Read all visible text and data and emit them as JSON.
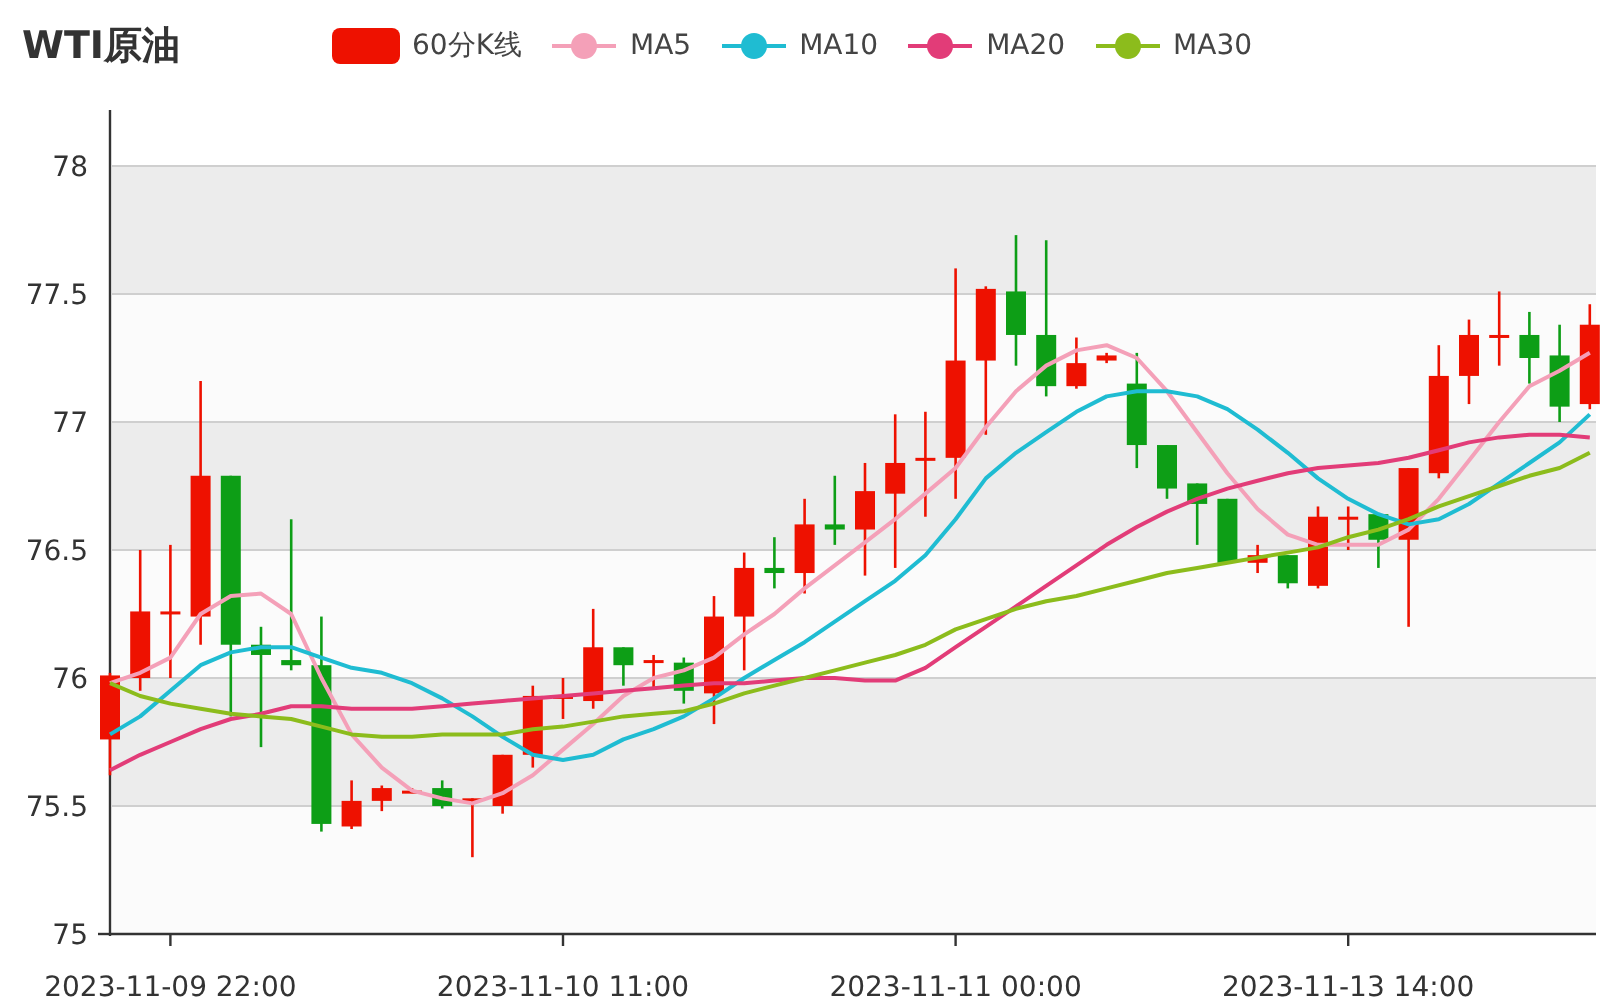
{
  "title": "WTI原油",
  "candle_legend": {
    "label": "60分K线",
    "color": "#ee1100"
  },
  "chart": {
    "chart_data": {
      "type": "candlestick",
      "grid": true,
      "ylim": [
        75,
        78
      ],
      "yticks": [
        75,
        75.5,
        76,
        76.5,
        77,
        77.5,
        78
      ],
      "categories": [
        null,
        null,
        "2023-11-09 22:00",
        null,
        null,
        null,
        null,
        null,
        null,
        null,
        null,
        null,
        null,
        null,
        null,
        "2023-11-10 11:00",
        null,
        null,
        null,
        null,
        null,
        null,
        null,
        null,
        null,
        null,
        null,
        null,
        "2023-11-11 00:00",
        null,
        null,
        null,
        null,
        null,
        null,
        null,
        null,
        null,
        null,
        null,
        null,
        "2023-11-13 14:00",
        null,
        null,
        null,
        null,
        null,
        null,
        null,
        null
      ],
      "ohlc": [
        [
          75.76,
          76.02,
          75.62,
          76.01
        ],
        [
          76.0,
          76.5,
          75.95,
          76.26
        ],
        [
          76.25,
          76.52,
          76.0,
          76.26
        ],
        [
          76.24,
          77.16,
          76.13,
          76.79
        ],
        [
          76.79,
          76.79,
          75.85,
          76.13
        ],
        [
          76.13,
          76.2,
          75.73,
          76.09
        ],
        [
          76.07,
          76.62,
          76.03,
          76.05
        ],
        [
          76.05,
          76.24,
          75.4,
          75.43
        ],
        [
          75.42,
          75.6,
          75.41,
          75.52
        ],
        [
          75.52,
          75.58,
          75.48,
          75.57
        ],
        [
          75.56,
          75.57,
          75.55,
          75.56
        ],
        [
          75.57,
          75.6,
          75.49,
          75.5
        ],
        [
          75.52,
          75.53,
          75.3,
          75.53
        ],
        [
          75.5,
          75.7,
          75.47,
          75.7
        ],
        [
          75.7,
          75.97,
          75.65,
          75.93
        ],
        [
          75.92,
          76.0,
          75.84,
          75.93
        ],
        [
          75.91,
          76.27,
          75.88,
          76.12
        ],
        [
          76.12,
          76.12,
          75.97,
          76.05
        ],
        [
          76.06,
          76.09,
          75.96,
          76.07
        ],
        [
          76.06,
          76.08,
          75.9,
          75.95
        ],
        [
          75.94,
          76.32,
          75.82,
          76.24
        ],
        [
          76.24,
          76.49,
          76.03,
          76.43
        ],
        [
          76.43,
          76.55,
          76.35,
          76.41
        ],
        [
          76.41,
          76.7,
          76.33,
          76.6
        ],
        [
          76.6,
          76.79,
          76.52,
          76.58
        ],
        [
          76.58,
          76.84,
          76.4,
          76.73
        ],
        [
          76.72,
          77.03,
          76.43,
          76.84
        ],
        [
          76.85,
          77.04,
          76.63,
          76.86
        ],
        [
          76.86,
          77.6,
          76.7,
          77.24
        ],
        [
          77.24,
          77.53,
          76.95,
          77.52
        ],
        [
          77.51,
          77.73,
          77.22,
          77.34
        ],
        [
          77.34,
          77.71,
          77.1,
          77.14
        ],
        [
          77.14,
          77.33,
          77.13,
          77.23
        ],
        [
          77.24,
          77.27,
          77.23,
          77.26
        ],
        [
          77.15,
          77.27,
          76.82,
          76.91
        ],
        [
          76.91,
          76.91,
          76.7,
          76.74
        ],
        [
          76.76,
          76.76,
          76.52,
          76.68
        ],
        [
          76.7,
          76.7,
          76.45,
          76.45
        ],
        [
          76.45,
          76.52,
          76.41,
          76.48
        ],
        [
          76.48,
          76.48,
          76.35,
          76.37
        ],
        [
          76.36,
          76.67,
          76.35,
          76.63
        ],
        [
          76.63,
          76.67,
          76.5,
          76.63
        ],
        [
          76.64,
          76.64,
          76.43,
          76.54
        ],
        [
          76.54,
          76.82,
          76.2,
          76.82
        ],
        [
          76.8,
          77.3,
          76.78,
          77.18
        ],
        [
          77.18,
          77.4,
          77.07,
          77.34
        ],
        [
          77.33,
          77.51,
          77.22,
          77.34
        ],
        [
          77.34,
          77.43,
          77.15,
          77.25
        ],
        [
          77.26,
          77.38,
          77.0,
          77.06
        ],
        [
          77.07,
          77.46,
          77.05,
          77.38
        ]
      ]
    }
  },
  "moving_averages": {
    "chart_data": {
      "type": "line",
      "ylim": [
        75,
        78
      ],
      "series": [
        {
          "name": "MA5",
          "color": "#f4a0b8",
          "values": [
            75.98,
            76.02,
            76.08,
            76.25,
            76.32,
            76.33,
            76.25,
            76.0,
            75.78,
            75.65,
            75.56,
            75.53,
            75.51,
            75.55,
            75.62,
            75.72,
            75.82,
            75.93,
            76.0,
            76.03,
            76.08,
            76.17,
            76.25,
            76.35,
            76.44,
            76.53,
            76.62,
            76.72,
            76.82,
            76.98,
            77.12,
            77.22,
            77.28,
            77.3,
            77.25,
            77.12,
            76.96,
            76.8,
            76.66,
            76.56,
            76.52,
            76.52,
            76.52,
            76.58,
            76.7,
            76.85,
            77.0,
            77.14,
            77.2,
            77.27
          ]
        },
        {
          "name": "MA10",
          "color": "#1fbcd2",
          "values": [
            75.78,
            75.85,
            75.95,
            76.05,
            76.1,
            76.12,
            76.12,
            76.08,
            76.04,
            76.02,
            75.98,
            75.92,
            75.85,
            75.77,
            75.7,
            75.68,
            75.7,
            75.76,
            75.8,
            75.85,
            75.92,
            76.0,
            76.07,
            76.14,
            76.22,
            76.3,
            76.38,
            76.48,
            76.62,
            76.78,
            76.88,
            76.96,
            77.04,
            77.1,
            77.12,
            77.12,
            77.1,
            77.05,
            76.97,
            76.88,
            76.78,
            76.7,
            76.64,
            76.6,
            76.62,
            76.68,
            76.76,
            76.84,
            76.92,
            77.03
          ]
        },
        {
          "name": "MA20",
          "color": "#e23c78",
          "values": [
            75.64,
            75.7,
            75.75,
            75.8,
            75.84,
            75.86,
            75.89,
            75.89,
            75.88,
            75.88,
            75.88,
            75.89,
            75.9,
            75.91,
            75.92,
            75.93,
            75.94,
            75.95,
            75.96,
            75.97,
            75.98,
            75.98,
            75.99,
            76.0,
            76.0,
            75.99,
            75.99,
            76.04,
            76.12,
            76.2,
            76.28,
            76.36,
            76.44,
            76.52,
            76.59,
            76.65,
            76.7,
            76.74,
            76.77,
            76.8,
            76.82,
            76.83,
            76.84,
            76.86,
            76.89,
            76.92,
            76.94,
            76.95,
            76.95,
            76.94
          ]
        },
        {
          "name": "MA30",
          "color": "#8cbc1c",
          "values": [
            75.98,
            75.93,
            75.9,
            75.88,
            75.86,
            75.85,
            75.84,
            75.81,
            75.78,
            75.77,
            75.77,
            75.78,
            75.78,
            75.78,
            75.8,
            75.81,
            75.83,
            75.85,
            75.86,
            75.87,
            75.9,
            75.94,
            75.97,
            76.0,
            76.03,
            76.06,
            76.09,
            76.13,
            76.19,
            76.23,
            76.27,
            76.3,
            76.32,
            76.35,
            76.38,
            76.41,
            76.43,
            76.45,
            76.47,
            76.49,
            76.51,
            76.55,
            76.58,
            76.62,
            76.67,
            76.71,
            76.75,
            76.79,
            76.82,
            76.88
          ]
        }
      ]
    }
  }
}
